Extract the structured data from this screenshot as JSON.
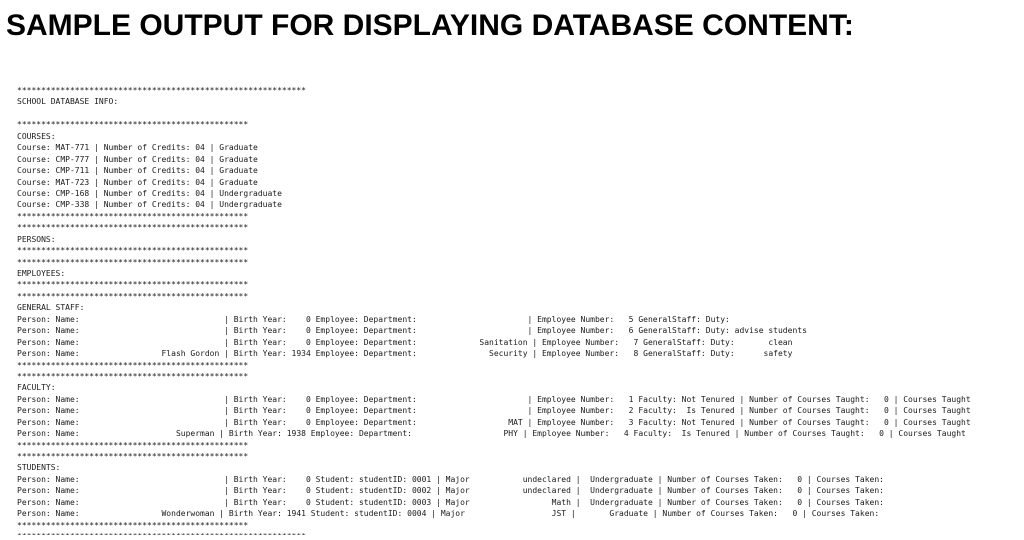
{
  "title": "SAMPLE OUTPUT FOR DISPLAYING DATABASE CONTENT:",
  "output_lines": [
    "************************************************************",
    "SCHOOL DATABASE INFO:",
    "",
    "************************************************",
    "COURSES:",
    "Course: MAT-771 | Number of Credits: 04 | Graduate",
    "Course: CMP-777 | Number of Credits: 04 | Graduate",
    "Course: CMP-711 | Number of Credits: 04 | Graduate",
    "Course: MAT-723 | Number of Credits: 04 | Graduate",
    "Course: CMP-168 | Number of Credits: 04 | Undergraduate",
    "Course: CMP-338 | Number of Credits: 04 | Undergraduate",
    "************************************************",
    "************************************************",
    "PERSONS:",
    "************************************************",
    "************************************************",
    "EMPLOYEES:",
    "************************************************",
    "************************************************",
    "GENERAL STAFF:",
    "Person: Name:                              | Birth Year:    0 Employee: Department:                       | Employee Number:   5 GeneralStaff: Duty:",
    "Person: Name:                              | Birth Year:    0 Employee: Department:                       | Employee Number:   6 GeneralStaff: Duty: advise students",
    "Person: Name:                              | Birth Year:    0 Employee: Department:             Sanitation | Employee Number:   7 GeneralStaff: Duty:       clean",
    "Person: Name:                 Flash Gordon | Birth Year: 1934 Employee: Department:               Security | Employee Number:   8 GeneralStaff: Duty:      safety",
    "************************************************",
    "************************************************",
    "FACULTY:",
    "Person: Name:                              | Birth Year:    0 Employee: Department:                       | Employee Number:   1 Faculty: Not Tenured | Number of Courses Taught:   0 | Courses Taught",
    "Person: Name:                              | Birth Year:    0 Employee: Department:                       | Employee Number:   2 Faculty:  Is Tenured | Number of Courses Taught:   0 | Courses Taught",
    "Person: Name:                              | Birth Year:    0 Employee: Department:                   MAT | Employee Number:   3 Faculty: Not Tenured | Number of Courses Taught:   0 | Courses Taught",
    "Person: Name:                    Superman | Birth Year: 1938 Employee: Department:                   PHY | Employee Number:   4 Faculty:  Is Tenured | Number of Courses Taught:   0 | Courses Taught",
    "************************************************",
    "************************************************",
    "STUDENTS:",
    "Person: Name:                              | Birth Year:    0 Student: studentID: 0001 | Major           undeclared |  Undergraduate | Number of Courses Taken:   0 | Courses Taken:",
    "Person: Name:                              | Birth Year:    0 Student: studentID: 0002 | Major           undeclared |  Undergraduate | Number of Courses Taken:   0 | Courses Taken:",
    "Person: Name:                              | Birth Year:    0 Student: studentID: 0003 | Major                 Math |  Undergraduate | Number of Courses Taken:   0 | Courses Taken:",
    "Person: Name:                 Wonderwoman | Birth Year: 1941 Student: studentID: 0004 | Major                  JST |       Graduate | Number of Courses Taken:   0 | Courses Taken:",
    "************************************************",
    "************************************************************"
  ]
}
